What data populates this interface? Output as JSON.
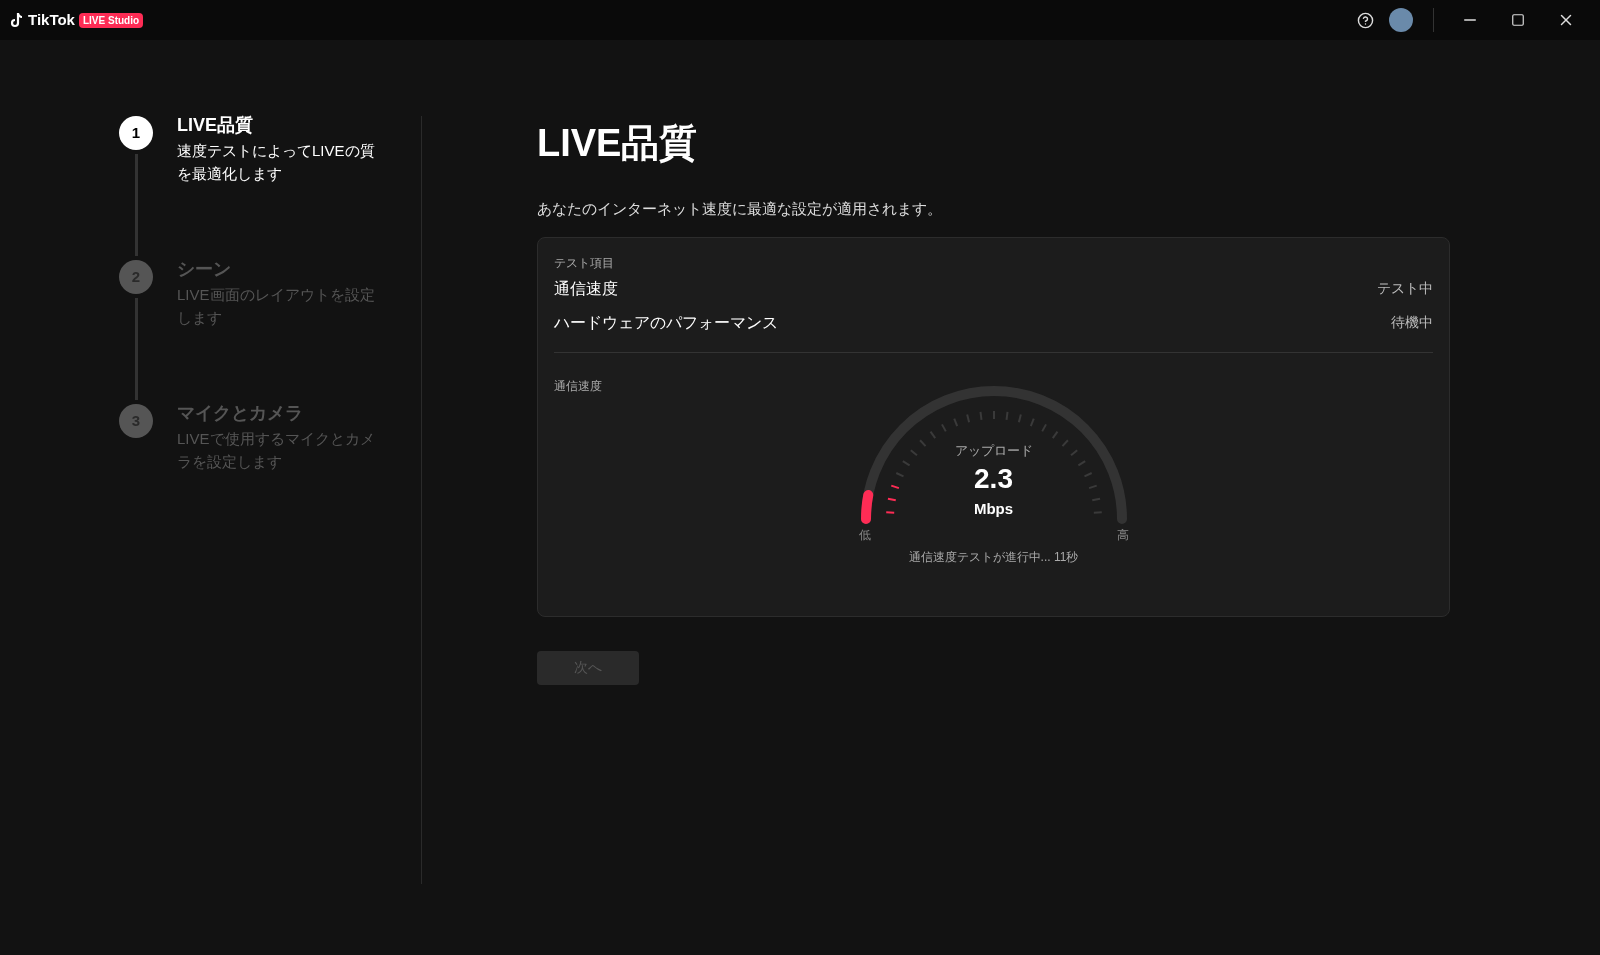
{
  "app": {
    "logo": "TikTok",
    "badge": "LIVE Studio"
  },
  "steps": [
    {
      "number": "1",
      "title": "LIVE品質",
      "description": "速度テストによってLIVEの質を最適化します",
      "selected": true
    },
    {
      "number": "2",
      "title": "シーン",
      "description": "LIVE画面のレイアウトを設定します",
      "selected": false
    },
    {
      "number": "3",
      "title": "マイクとカメラ",
      "description": "LIVEで使用するマイクとカメラを設定します",
      "selected": false
    }
  ],
  "main": {
    "title": "LIVE品質",
    "subtitle": "あなたのインターネット速度に最適な設定が適用されます。"
  },
  "test_card": {
    "heading": "テスト項目",
    "items": [
      {
        "name": "通信速度",
        "status": "テスト中"
      },
      {
        "name": "ハードウェアのパフォーマンス",
        "status": "待機中"
      }
    ],
    "section_label": "通信速度",
    "gauge": {
      "label": "アップロード",
      "value": "2.3",
      "unit": "Mbps",
      "level": 0.06,
      "low_label": "低",
      "high_label": "高"
    },
    "progress_text": "通信速度テストが進行中... 11秒"
  },
  "next_button": {
    "label": "次へ",
    "disabled": true
  }
}
